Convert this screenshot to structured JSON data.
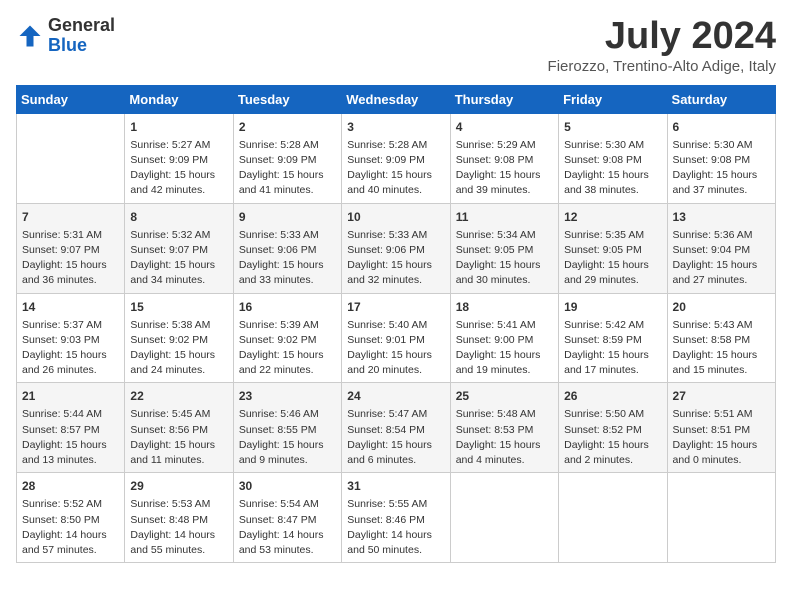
{
  "header": {
    "logo_line1": "General",
    "logo_line2": "Blue",
    "main_title": "July 2024",
    "subtitle": "Fierozzo, Trentino-Alto Adige, Italy"
  },
  "weekdays": [
    "Sunday",
    "Monday",
    "Tuesday",
    "Wednesday",
    "Thursday",
    "Friday",
    "Saturday"
  ],
  "weeks": [
    [
      {
        "num": "",
        "info": ""
      },
      {
        "num": "1",
        "info": "Sunrise: 5:27 AM\nSunset: 9:09 PM\nDaylight: 15 hours\nand 42 minutes."
      },
      {
        "num": "2",
        "info": "Sunrise: 5:28 AM\nSunset: 9:09 PM\nDaylight: 15 hours\nand 41 minutes."
      },
      {
        "num": "3",
        "info": "Sunrise: 5:28 AM\nSunset: 9:09 PM\nDaylight: 15 hours\nand 40 minutes."
      },
      {
        "num": "4",
        "info": "Sunrise: 5:29 AM\nSunset: 9:08 PM\nDaylight: 15 hours\nand 39 minutes."
      },
      {
        "num": "5",
        "info": "Sunrise: 5:30 AM\nSunset: 9:08 PM\nDaylight: 15 hours\nand 38 minutes."
      },
      {
        "num": "6",
        "info": "Sunrise: 5:30 AM\nSunset: 9:08 PM\nDaylight: 15 hours\nand 37 minutes."
      }
    ],
    [
      {
        "num": "7",
        "info": "Sunrise: 5:31 AM\nSunset: 9:07 PM\nDaylight: 15 hours\nand 36 minutes."
      },
      {
        "num": "8",
        "info": "Sunrise: 5:32 AM\nSunset: 9:07 PM\nDaylight: 15 hours\nand 34 minutes."
      },
      {
        "num": "9",
        "info": "Sunrise: 5:33 AM\nSunset: 9:06 PM\nDaylight: 15 hours\nand 33 minutes."
      },
      {
        "num": "10",
        "info": "Sunrise: 5:33 AM\nSunset: 9:06 PM\nDaylight: 15 hours\nand 32 minutes."
      },
      {
        "num": "11",
        "info": "Sunrise: 5:34 AM\nSunset: 9:05 PM\nDaylight: 15 hours\nand 30 minutes."
      },
      {
        "num": "12",
        "info": "Sunrise: 5:35 AM\nSunset: 9:05 PM\nDaylight: 15 hours\nand 29 minutes."
      },
      {
        "num": "13",
        "info": "Sunrise: 5:36 AM\nSunset: 9:04 PM\nDaylight: 15 hours\nand 27 minutes."
      }
    ],
    [
      {
        "num": "14",
        "info": "Sunrise: 5:37 AM\nSunset: 9:03 PM\nDaylight: 15 hours\nand 26 minutes."
      },
      {
        "num": "15",
        "info": "Sunrise: 5:38 AM\nSunset: 9:02 PM\nDaylight: 15 hours\nand 24 minutes."
      },
      {
        "num": "16",
        "info": "Sunrise: 5:39 AM\nSunset: 9:02 PM\nDaylight: 15 hours\nand 22 minutes."
      },
      {
        "num": "17",
        "info": "Sunrise: 5:40 AM\nSunset: 9:01 PM\nDaylight: 15 hours\nand 20 minutes."
      },
      {
        "num": "18",
        "info": "Sunrise: 5:41 AM\nSunset: 9:00 PM\nDaylight: 15 hours\nand 19 minutes."
      },
      {
        "num": "19",
        "info": "Sunrise: 5:42 AM\nSunset: 8:59 PM\nDaylight: 15 hours\nand 17 minutes."
      },
      {
        "num": "20",
        "info": "Sunrise: 5:43 AM\nSunset: 8:58 PM\nDaylight: 15 hours\nand 15 minutes."
      }
    ],
    [
      {
        "num": "21",
        "info": "Sunrise: 5:44 AM\nSunset: 8:57 PM\nDaylight: 15 hours\nand 13 minutes."
      },
      {
        "num": "22",
        "info": "Sunrise: 5:45 AM\nSunset: 8:56 PM\nDaylight: 15 hours\nand 11 minutes."
      },
      {
        "num": "23",
        "info": "Sunrise: 5:46 AM\nSunset: 8:55 PM\nDaylight: 15 hours\nand 9 minutes."
      },
      {
        "num": "24",
        "info": "Sunrise: 5:47 AM\nSunset: 8:54 PM\nDaylight: 15 hours\nand 6 minutes."
      },
      {
        "num": "25",
        "info": "Sunrise: 5:48 AM\nSunset: 8:53 PM\nDaylight: 15 hours\nand 4 minutes."
      },
      {
        "num": "26",
        "info": "Sunrise: 5:50 AM\nSunset: 8:52 PM\nDaylight: 15 hours\nand 2 minutes."
      },
      {
        "num": "27",
        "info": "Sunrise: 5:51 AM\nSunset: 8:51 PM\nDaylight: 15 hours\nand 0 minutes."
      }
    ],
    [
      {
        "num": "28",
        "info": "Sunrise: 5:52 AM\nSunset: 8:50 PM\nDaylight: 14 hours\nand 57 minutes."
      },
      {
        "num": "29",
        "info": "Sunrise: 5:53 AM\nSunset: 8:48 PM\nDaylight: 14 hours\nand 55 minutes."
      },
      {
        "num": "30",
        "info": "Sunrise: 5:54 AM\nSunset: 8:47 PM\nDaylight: 14 hours\nand 53 minutes."
      },
      {
        "num": "31",
        "info": "Sunrise: 5:55 AM\nSunset: 8:46 PM\nDaylight: 14 hours\nand 50 minutes."
      },
      {
        "num": "",
        "info": ""
      },
      {
        "num": "",
        "info": ""
      },
      {
        "num": "",
        "info": ""
      }
    ]
  ]
}
